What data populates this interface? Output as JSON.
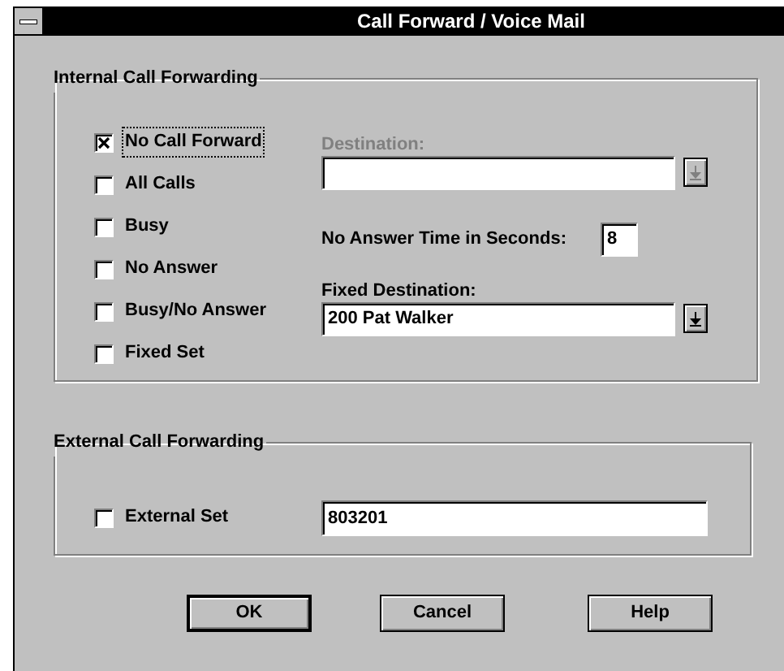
{
  "window": {
    "title": "Call Forward / Voice Mail"
  },
  "internal": {
    "title": "Internal Call Forwarding",
    "options": [
      {
        "label": "No Call Forward",
        "checked": true,
        "focused": true
      },
      {
        "label": "All Calls",
        "checked": false,
        "focused": false
      },
      {
        "label": "Busy",
        "checked": false,
        "focused": false
      },
      {
        "label": "No Answer",
        "checked": false,
        "focused": false
      },
      {
        "label": "Busy/No Answer",
        "checked": false,
        "focused": false
      },
      {
        "label": "Fixed Set",
        "checked": false,
        "focused": false
      }
    ],
    "destination": {
      "label": "Destination:",
      "disabled": true
    },
    "no_answer_time": {
      "label": "No Answer Time in Seconds:",
      "value": "8"
    },
    "fixed_destination": {
      "label": "Fixed Destination:",
      "value": "200 Pat Walker",
      "disabled": false
    }
  },
  "external": {
    "title": "External Call Forwarding",
    "option": {
      "label": "External Set",
      "checked": false
    },
    "value": "803201"
  },
  "buttons": [
    {
      "label": "OK",
      "default": true
    },
    {
      "label": "Cancel",
      "default": false
    },
    {
      "label": "Help",
      "default": false
    }
  ]
}
